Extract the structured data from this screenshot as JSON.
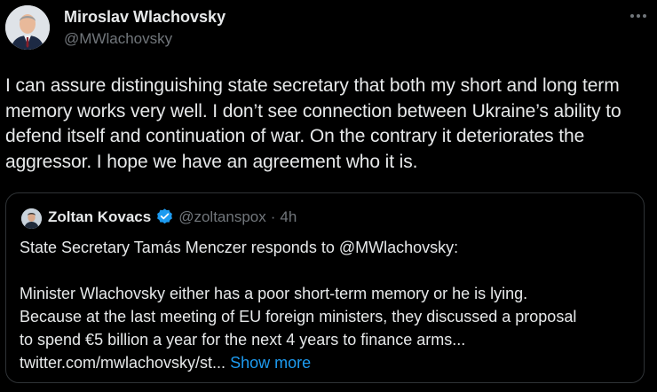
{
  "tweet": {
    "author_name": "Miroslav Wlachovsky",
    "author_handle": "@MWlachovsky",
    "more_icon": "more-horizontal-icon",
    "text": "I can assure distinguishing state secretary that both my short and long term memory works very well. I don’t see connection between Ukraine’s ability to defend itself and continuation of war. On the contrary it deteriorates the aggressor. I hope we have an agreement who it is."
  },
  "quote": {
    "author_name": "Zoltan Kovacs",
    "verified_icon": "verified-badge-icon",
    "author_handle": "@zoltanspox",
    "separator": "·",
    "time": "4h",
    "lines": [
      "State Secretary Tamás Menczer responds to @MWlachovsky:",
      "Minister Wlachovsky either has a poor short-term memory or he is lying.",
      "Because at the last meeting of EU foreign ministers, they discussed a proposal",
      "to spend €5 billion a year for the next 4 years to finance arms...",
      "twitter.com/mwlachovsky/st..."
    ],
    "show_more": "Show more"
  },
  "colors": {
    "background": "#000000",
    "text_primary": "#e7e9ea",
    "text_secondary": "#71767b",
    "link": "#1d9bf0",
    "border": "#2f3336"
  }
}
